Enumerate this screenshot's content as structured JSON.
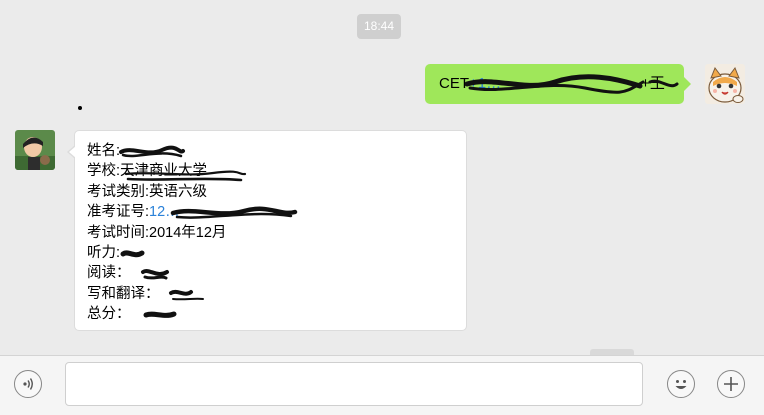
{
  "chat": {
    "timestamp": "18:44",
    "sent_message": {
      "prefix": "CET",
      "number_visible": "+1…",
      "suffix": "+王"
    },
    "received_message": {
      "lines": [
        {
          "label": "姓名:",
          "value": ""
        },
        {
          "label": "学校:",
          "value": "天津商业大学"
        },
        {
          "label": "考试类别:",
          "value": "英语六级"
        },
        {
          "label": "准考证号:",
          "value": "12…"
        },
        {
          "label": "考试时间:",
          "value": "2014年12月"
        },
        {
          "label": "听力:",
          "value": ""
        },
        {
          "label": "阅读：",
          "value": ""
        },
        {
          "label": "写和翻译：",
          "value": ""
        },
        {
          "label": "总分：",
          "value": ""
        }
      ]
    }
  },
  "input_bar": {
    "text_value": "",
    "icons": [
      "voice-icon",
      "emoji-icon",
      "plus-icon"
    ]
  },
  "colors": {
    "background": "#ebebeb",
    "sent_bubble": "#9fe75a",
    "link_blue": "#2b82d9",
    "timestamp_bg": "#cfcfcf"
  }
}
